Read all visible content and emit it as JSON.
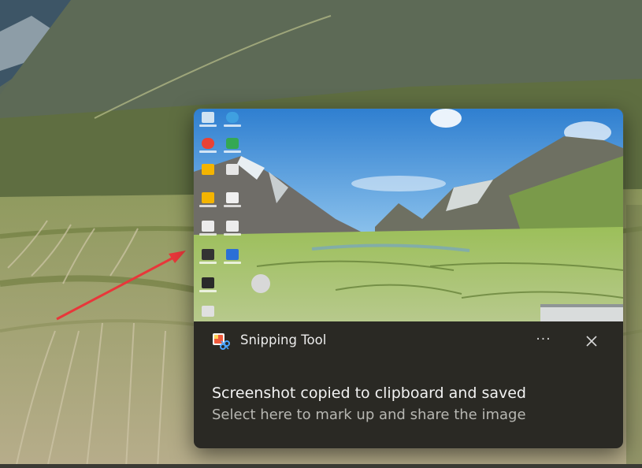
{
  "colors": {
    "toast_background": "#2a2924",
    "title_text": "#f2f2f2",
    "subtitle_text": "#b7b7b2",
    "annotation_arrow": "#e8373a"
  },
  "notification": {
    "app_name": "Snipping Tool",
    "app_icon": "snipping-tool-icon",
    "more_icon": "ellipsis-icon",
    "more_label": "···",
    "close_icon": "close-icon",
    "title": "Screenshot copied to clipboard and saved",
    "subtitle": "Select here to mark up and share the image"
  }
}
